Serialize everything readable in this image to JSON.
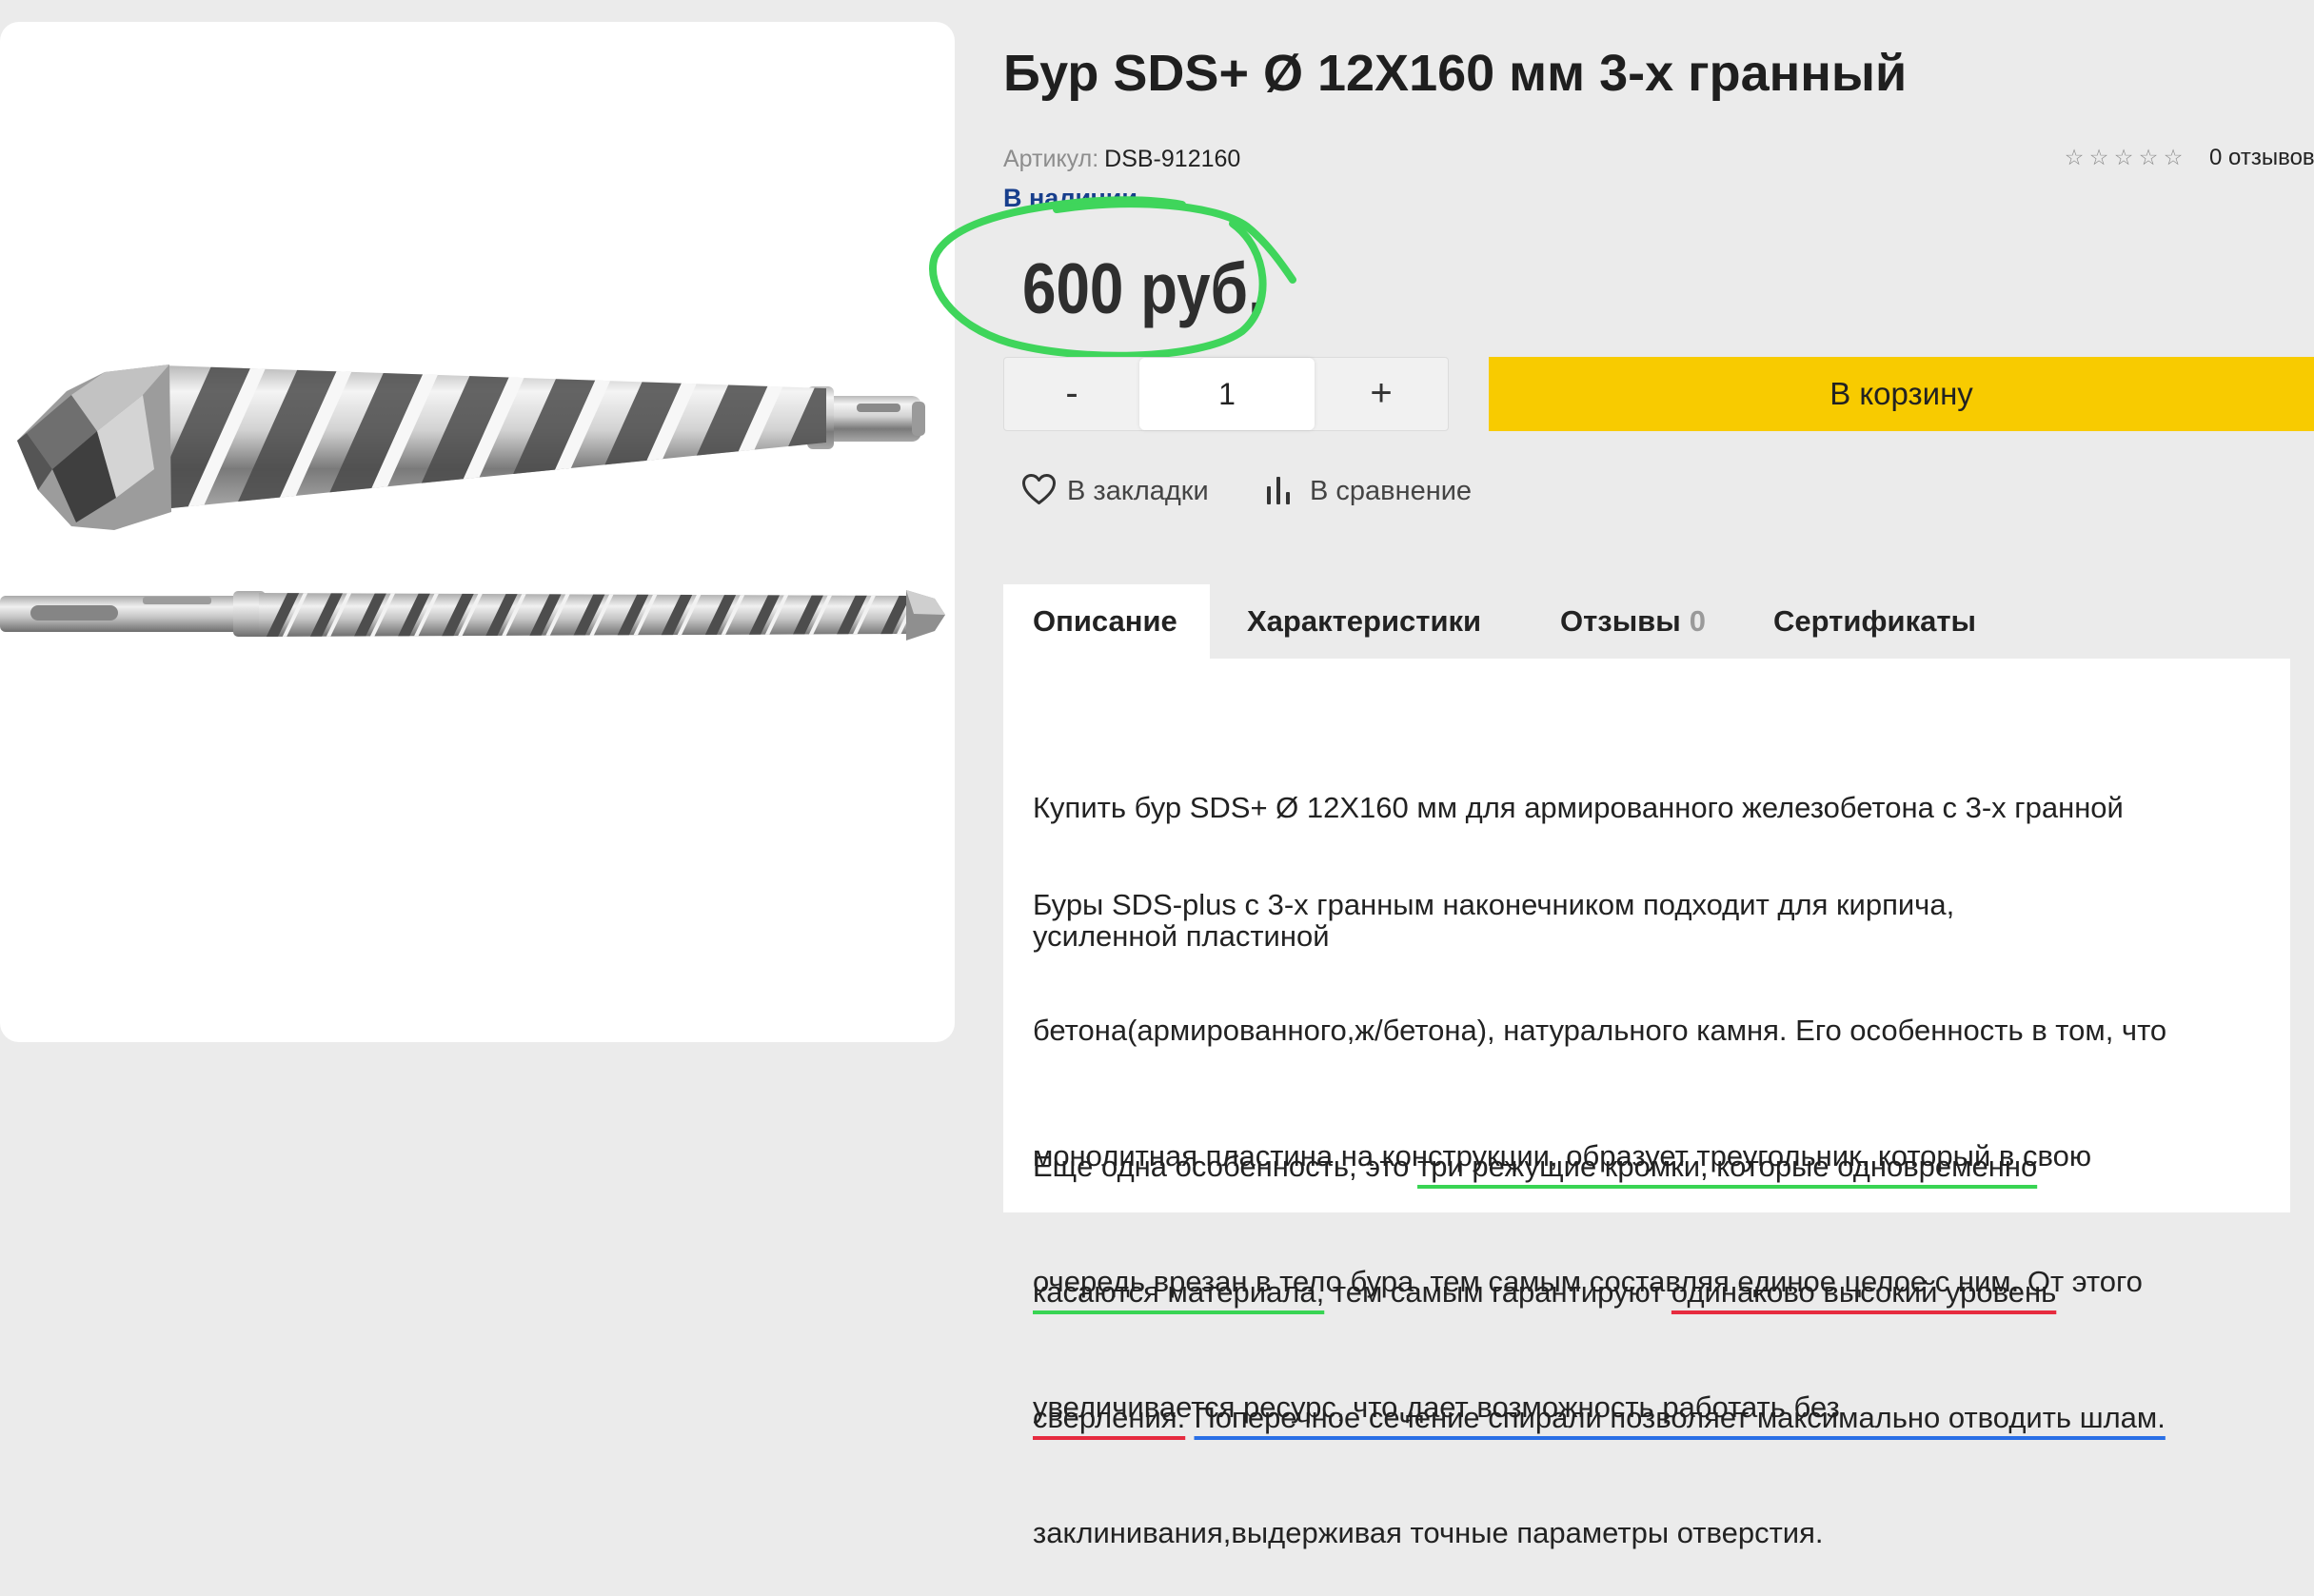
{
  "product": {
    "title": "Бур SDS+ Ø 12Х160 мм 3-х гранный",
    "sku_label": "Артикул:",
    "sku": "DSB-912160",
    "availability": "В наличии",
    "rating": {
      "value": 0,
      "max": 5,
      "reviews": "0 отзывов"
    },
    "price": "600 руб."
  },
  "purchase": {
    "minus": "-",
    "quantity": "1",
    "plus": "+",
    "add_to_cart": "В корзину"
  },
  "actions": {
    "bookmark": "В закладки",
    "compare": "В сравнение"
  },
  "tabs": [
    {
      "label": "Описание",
      "active": true
    },
    {
      "label": "Характеристики",
      "active": false
    },
    {
      "label": "Отзывы",
      "count": "0",
      "active": false
    },
    {
      "label": "Сертификаты",
      "active": false
    }
  ],
  "description": {
    "p1": [
      "Купить бур SDS+ Ø 12Х160 мм для армированного железобетона с 3-х гранной",
      "усиленной пластиной"
    ],
    "p2": [
      "Буры SDS-plus с 3-х гранным наконечником подходит для кирпича,",
      "бетона(армированного,ж/бетона), натурального камня. Его особенность в том, что",
      "монолитная пластина на конструкции, образует треугольник, который в свою",
      "очередь врезан в тело бура, тем самым составляя единое целое с ним. От этого",
      "увеличивается ресурс, что дает возможность работать без",
      "заклинивания,выдерживая точные параметры отверстия."
    ],
    "p3": [
      [
        "Ещё одна особенность, это ",
        "три режущие кромки, которые одновременно"
      ],
      [
        "касаются материала,",
        " тем самым гарантируют ",
        "одинаково высокий уровень"
      ],
      [
        "сверления.",
        "Поперечное сечение спирали позволяет максимально отводить шлам."
      ]
    ]
  },
  "colors": {
    "page_background": "#ebebeb",
    "cart_button": "#f8cb00",
    "availability": "#173e8c",
    "price_highlight": "#3fd55b",
    "underline_green": "#38d453",
    "underline_red": "#e62b3f",
    "underline_blue": "#2a6fe6"
  },
  "icons": {
    "bookmark": "heart-icon",
    "compare": "bar-chart-icon",
    "rating": "star-icon"
  }
}
